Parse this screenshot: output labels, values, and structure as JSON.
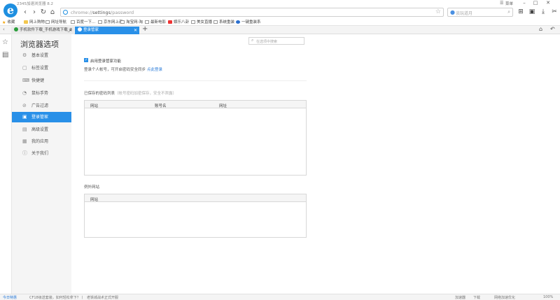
{
  "window": {
    "title": "2345加速浏览器 8.2",
    "menu_label": "菜单",
    "minimize": "–",
    "maximize": "□",
    "close": "✕"
  },
  "nav": {
    "url_prefix": "chrome://",
    "url_path": "settings",
    "url_suffix": "/password",
    "search_placeholder": "谈玩道月"
  },
  "bookmarks": [
    {
      "label": "收藏",
      "icon": "star"
    },
    {
      "label": "网上购物",
      "icon": "folder"
    },
    {
      "label": "网址导航",
      "icon": "page"
    },
    {
      "label": "百度一下...",
      "icon": "page"
    },
    {
      "label": "京东网上商",
      "icon": "page"
    },
    {
      "label": "淘宝网-淘",
      "icon": "page"
    },
    {
      "label": "最新电影",
      "icon": "page"
    },
    {
      "label": "娱乐八卦",
      "icon": "red"
    },
    {
      "label": "美女直播",
      "icon": "page"
    },
    {
      "label": "系统重装",
      "icon": "page"
    },
    {
      "label": "一键重装系",
      "icon": "blue"
    }
  ],
  "tabs": [
    {
      "label": "手机软件下载_手机游戏下载_3",
      "active": false
    },
    {
      "label": "登录管家",
      "active": true
    }
  ],
  "sidebar": {
    "title": "浏览器选项",
    "items": [
      {
        "label": "基本设置",
        "icon": "⚙"
      },
      {
        "label": "标签设置",
        "icon": "▢"
      },
      {
        "label": "快捷键",
        "icon": "⌨"
      },
      {
        "label": "鼠标手势",
        "icon": "◔"
      },
      {
        "label": "广告过滤",
        "icon": "⊘"
      },
      {
        "label": "登录管家",
        "icon": "🔒"
      },
      {
        "label": "高级设置",
        "icon": "▤"
      },
      {
        "label": "我的应用",
        "icon": "▦"
      },
      {
        "label": "关于我们",
        "icon": "ⓘ"
      }
    ],
    "active_index": 5
  },
  "main": {
    "search_placeholder": "在选项中搜索",
    "enable_label": "启用登录管家功能",
    "enable_checked": true,
    "login_hint": "登录个人帐号，可开启密码安全同步",
    "login_link": "点此登录",
    "saved_title": "已保存的密码列表",
    "saved_note": "（帐号密码加密保存，安全不泄露）",
    "saved_columns": [
      "网站",
      "账号名",
      "网址"
    ],
    "exceptions_title": "例外网站",
    "exceptions_columns": [
      "网站"
    ]
  },
  "status": {
    "left": "今日特惠",
    "items": [
      "CF18级送套装，如何轻松拿下？丨",
      "老铁城战术正式开服"
    ],
    "right": [
      "加速器",
      "下载",
      "",
      "网络加速优化",
      "100%"
    ]
  }
}
